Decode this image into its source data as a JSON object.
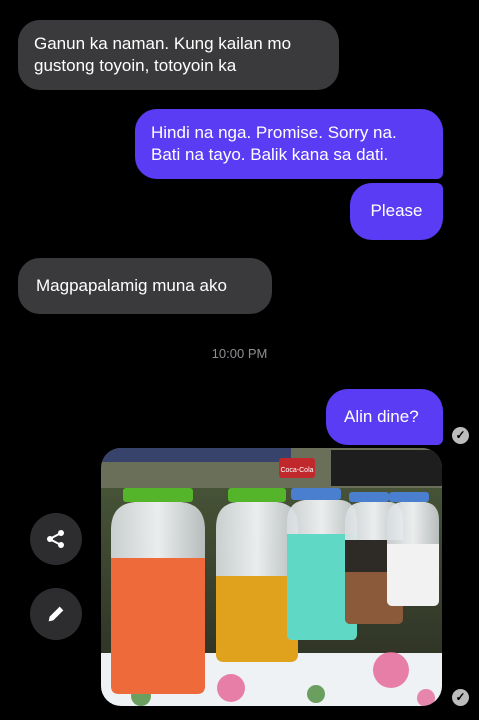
{
  "messages": [
    {
      "direction": "incoming",
      "text": "Ganun ka naman. Kung kailan mo\ngustong toyoin, totoyoin ka"
    },
    {
      "direction": "outgoing",
      "text": "Hindi na nga. Promise. Sorry na.\nBati na tayo. Balik kana sa dati."
    },
    {
      "direction": "outgoing",
      "text": "Please"
    },
    {
      "direction": "incoming",
      "text": "Magpapalamig muna ako"
    },
    {
      "direction": "outgoing",
      "text": "Alin dine?"
    }
  ],
  "timestamp": "10:00 PM",
  "read_receipt_icon": "check-circle-icon",
  "actions": {
    "share_icon": "share-icon",
    "edit_icon": "pencil-icon"
  },
  "photo_sign_text": "Coca-Cola",
  "colors": {
    "outgoing_bubble": "#5b3cf5",
    "incoming_bubble": "#3a3a3c",
    "background": "#000000"
  }
}
